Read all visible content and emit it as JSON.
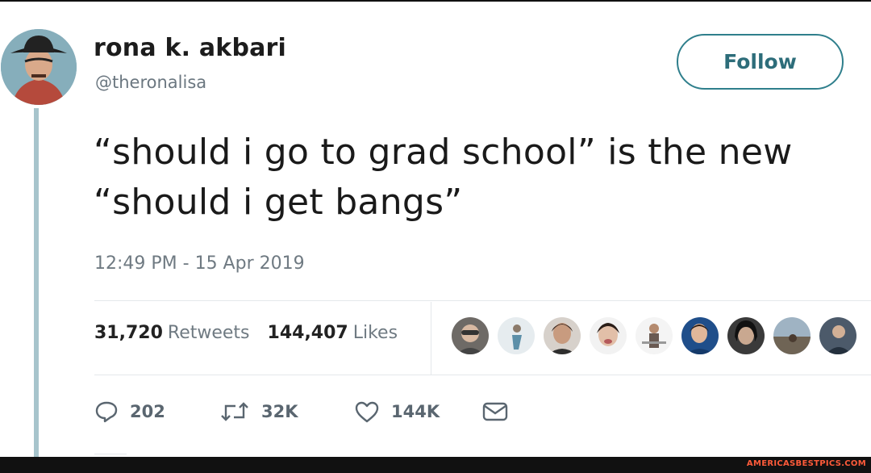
{
  "tweet": {
    "author_name": "rona k. akbari",
    "author_handle": "@theronalisa",
    "follow_label": "Follow",
    "text_line1": "“should i go to grad school” is the new",
    "text_line2": "“should i get bangs”",
    "timestamp": "12:49 PM - 15 Apr 2019"
  },
  "stats": {
    "retweets_count": "31,720",
    "retweets_label": "Retweets",
    "likes_count": "144,407",
    "likes_label": "Likes"
  },
  "actions": {
    "reply_count": "202",
    "retweet_count": "32K",
    "like_count": "144K"
  },
  "icons": [
    "reply-icon",
    "retweet-icon",
    "heart-icon",
    "message-icon"
  ],
  "colors": {
    "accent": "#2f7f8c",
    "thread_line": "#a7c4cc",
    "muted_text": "#6f7a82"
  },
  "watermark": "AMERICASBESTPICS.COM"
}
